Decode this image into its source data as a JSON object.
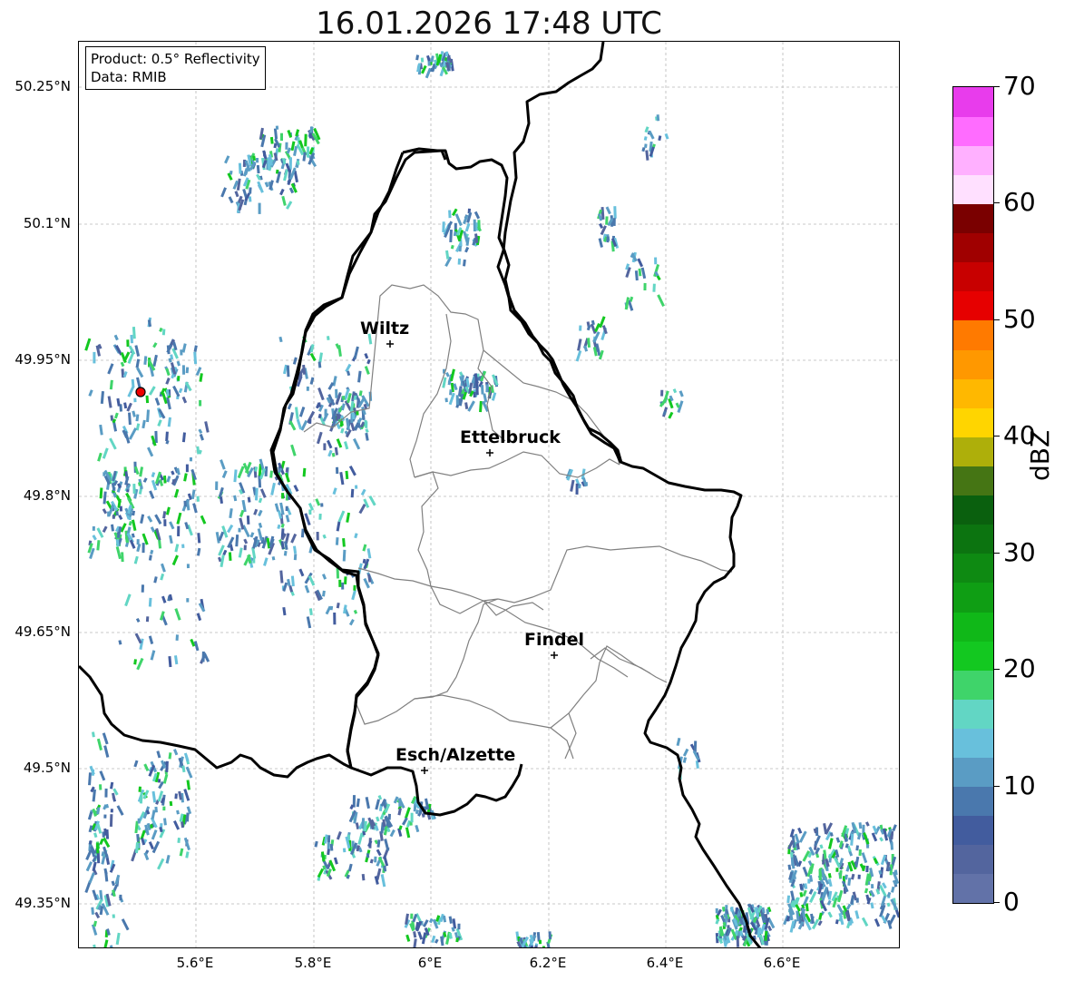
{
  "title": "16.01.2026 17:48 UTC",
  "info": {
    "product": "Product: 0.5° Reflectivity",
    "data": "Data: RMIB"
  },
  "lat_labels": [
    "50.25°N",
    "50.1°N",
    "49.95°N",
    "49.8°N",
    "49.65°N",
    "49.5°N",
    "49.35°N"
  ],
  "lon_labels": [
    "5.6°E",
    "5.8°E",
    "6°E",
    "6.2°E",
    "6.4°E",
    "6.6°E"
  ],
  "cities": [
    {
      "name": "Wiltz"
    },
    {
      "name": "Ettelbruck"
    },
    {
      "name": "Findel"
    },
    {
      "name": "Esch/Alzette"
    }
  ],
  "colorbar": {
    "label": "dBZ",
    "ticks": [
      "0",
      "10",
      "20",
      "30",
      "40",
      "50",
      "60",
      "70"
    ],
    "colors": [
      "#6272a8",
      "#53659e",
      "#425c9e",
      "#4a78ad",
      "#5a9cc4",
      "#68c0dc",
      "#62d6c4",
      "#3fd46a",
      "#13c820",
      "#10b818",
      "#0f9e14",
      "#0e8a12",
      "#0c7410",
      "#0a600e",
      "#457514",
      "#aeaf0a",
      "#ffd500",
      "#ffb800",
      "#ff9800",
      "#ff7a00",
      "#e60000",
      "#c80000",
      "#a00000",
      "#7a0000",
      "#ffe0ff",
      "#ffb0ff",
      "#ff6cff",
      "#e83cec"
    ]
  },
  "radar_site": {
    "name": "radar-site"
  }
}
